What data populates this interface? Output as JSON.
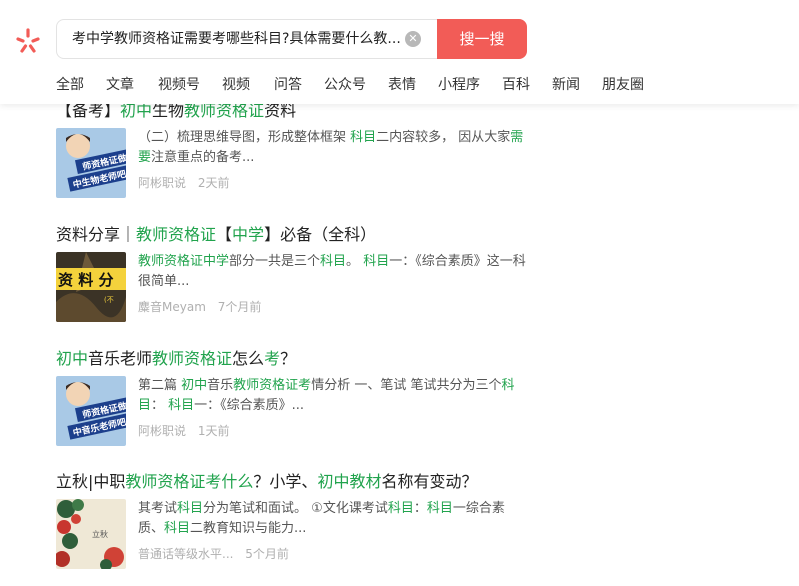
{
  "search": {
    "query": "考中学教师资格证需要考哪些科目?具体需要什么教...",
    "button_label": "搜一搜"
  },
  "tabs": [
    "全部",
    "文章",
    "视频号",
    "视频",
    "问答",
    "公众号",
    "表情",
    "小程序",
    "百科",
    "新闻",
    "朋友圈"
  ],
  "results": [
    {
      "title_parts": [
        [
          "【备考】",
          0
        ],
        [
          "初中",
          1
        ],
        [
          "生物",
          0
        ],
        [
          "教师资格证",
          1
        ],
        [
          "资料",
          0
        ]
      ],
      "desc_parts": [
        [
          "（二）梳理思维导图，形成整体框架 ",
          0
        ],
        [
          "科目",
          1
        ],
        [
          "二内容较多， 因从大家",
          0
        ],
        [
          "需要",
          1
        ],
        [
          "注意重点的备考...",
          0
        ]
      ],
      "source": "阿彬职说",
      "time": "2天前",
      "thumb_text": "师资格证做个中生物老师吧"
    },
    {
      "title_parts": [
        [
          "资料分享｜",
          0
        ],
        [
          "教师资格证",
          1
        ],
        [
          "【",
          0
        ],
        [
          "中学",
          1
        ],
        [
          "】必备（全科）",
          0
        ]
      ],
      "desc_parts": [
        [
          "教师资格证中学",
          1
        ],
        [
          "部分一共是三个",
          0
        ],
        [
          "科目",
          1
        ],
        [
          "。 ",
          0
        ],
        [
          "科目",
          1
        ],
        [
          "一：《综合素质》这一科很简单...",
          0
        ]
      ],
      "source": "麋音Meyam",
      "time": "7个月前",
      "thumb_text": "资 料 分"
    },
    {
      "title_parts": [
        [
          "初中",
          1
        ],
        [
          "音乐老师",
          0
        ],
        [
          "教师资格证",
          1
        ],
        [
          "怎么",
          0
        ],
        [
          "考",
          1
        ],
        [
          "？",
          0
        ]
      ],
      "desc_parts": [
        [
          "第二篇 ",
          0
        ],
        [
          "初中",
          1
        ],
        [
          "音乐",
          0
        ],
        [
          "教师资格证考",
          1
        ],
        [
          "情分析 一、笔试 笔试共分为三个",
          0
        ],
        [
          "科目",
          1
        ],
        [
          "： ",
          0
        ],
        [
          "科目",
          1
        ],
        [
          "一：《综合素质》...",
          0
        ]
      ],
      "source": "阿彬职说",
      "time": "1天前",
      "thumb_text": "师资格证做个中音乐老师吧"
    },
    {
      "title_parts": [
        [
          "立秋|中职",
          0
        ],
        [
          "教师资格证考什么",
          1
        ],
        [
          "？小学、",
          0
        ],
        [
          "初中教材",
          1
        ],
        [
          "名称有变动？",
          0
        ]
      ],
      "desc_parts": [
        [
          "其考试",
          0
        ],
        [
          "科目",
          1
        ],
        [
          "分为笔试和面试。 ①文化课考试",
          0
        ],
        [
          "科目",
          1
        ],
        [
          "：",
          0
        ],
        [
          "科目",
          1
        ],
        [
          "一综合素质、",
          0
        ],
        [
          "科目",
          1
        ],
        [
          "二教育知识与能力...",
          0
        ]
      ],
      "source": "普通话等级水平...",
      "time": "5个月前",
      "thumb_text": "立秋"
    }
  ],
  "colors": {
    "accent_green": "#21a34d",
    "search_button": "#f25c57",
    "meta_gray": "#b0b0b0"
  }
}
